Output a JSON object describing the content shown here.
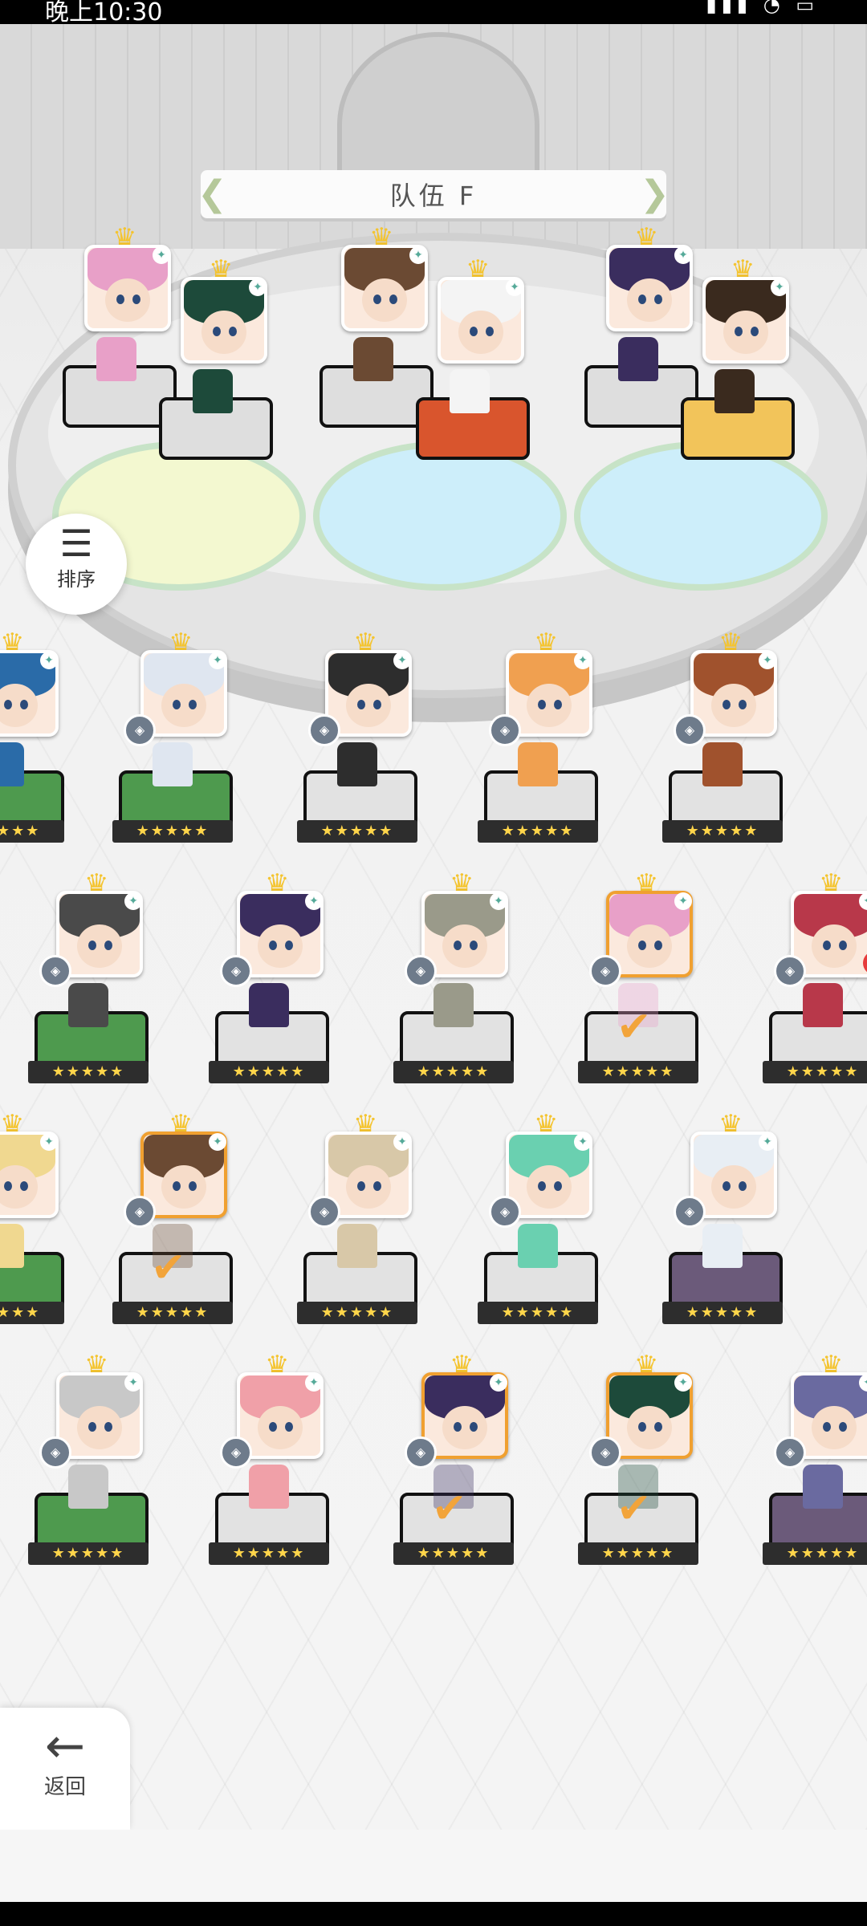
{
  "status_bar": {
    "time": "晚上10:30",
    "icons_text": "▮▮▮ ◔ ▭"
  },
  "team": {
    "title": "队伍 F"
  },
  "sort": {
    "label": "排序",
    "icon": "sort-icon"
  },
  "back": {
    "label": "返回",
    "icon": "arrow-left-icon"
  },
  "colors": {
    "selected_border": "#f0a030",
    "check": "#f2a43a",
    "alert": "#e63b3b",
    "crown": "#f4c430"
  },
  "team_slots": [
    {
      "hair": "#e8a0c8",
      "pedestal": "#dedede"
    },
    {
      "hair": "#1d4a3a",
      "pedestal": "#dedede"
    },
    {
      "hair": "#6b4a33",
      "pedestal": "#dedede"
    },
    {
      "hair": "#f4f4f4",
      "pedestal": "#d9552d"
    },
    {
      "hair": "#3a2d5e",
      "pedestal": "#dedede"
    },
    {
      "hair": "#3a2a1e",
      "pedestal": "#f2c45a"
    }
  ],
  "roster": [
    {
      "hair": "#2a6ba8",
      "pedestal": "#4e9a4e",
      "stars": "★★★★★",
      "selected": false
    },
    {
      "hair": "#dfe6f0",
      "pedestal": "#4e9a4e",
      "stars": "★★★★★",
      "selected": false
    },
    {
      "hair": "#2d2d2d",
      "pedestal": "#e2e2e2",
      "stars": "★★★★★",
      "selected": false
    },
    {
      "hair": "#f0a050",
      "pedestal": "#e2e2e2",
      "stars": "★★★★★",
      "selected": false
    },
    {
      "hair": "#a0522d",
      "pedestal": "#e2e2e2",
      "stars": "★★★★★",
      "selected": false
    },
    {
      "hair": "#4a4a4a",
      "pedestal": "#4e9a4e",
      "stars": "★★★★★",
      "selected": false
    },
    {
      "hair": "#3a2d5e",
      "pedestal": "#e2e2e2",
      "stars": "★★★★★",
      "selected": false
    },
    {
      "hair": "#9a9a8a",
      "pedestal": "#e2e2e2",
      "stars": "★★★★★",
      "selected": false
    },
    {
      "hair": "#e8a0c8",
      "pedestal": "#e2e2e2",
      "stars": "★★★★★",
      "selected": true
    },
    {
      "hair": "#b8384a",
      "pedestal": "#e2e2e2",
      "stars": "★★★★★",
      "selected": false,
      "alert": "!"
    },
    {
      "hair": "#f0d890",
      "pedestal": "#4e9a4e",
      "stars": "★★★★★",
      "selected": false
    },
    {
      "hair": "#6b4a33",
      "pedestal": "#e2e2e2",
      "stars": "★★★★★",
      "selected": true
    },
    {
      "hair": "#d8c8a8",
      "pedestal": "#e2e2e2",
      "stars": "★★★★★",
      "selected": false
    },
    {
      "hair": "#6ad0b0",
      "pedestal": "#e2e2e2",
      "stars": "★★★★★",
      "selected": false
    },
    {
      "hair": "#e8eef4",
      "pedestal": "#6b5a7a",
      "stars": "★★★★★",
      "selected": false
    },
    {
      "hair": "#c8c8c8",
      "pedestal": "#4e9a4e",
      "stars": "★★★★★",
      "selected": false
    },
    {
      "hair": "#f0a0a8",
      "pedestal": "#e2e2e2",
      "stars": "★★★★★",
      "selected": false
    },
    {
      "hair": "#3a2d5e",
      "pedestal": "#e2e2e2",
      "stars": "★★★★★",
      "selected": true
    },
    {
      "hair": "#1d4a3a",
      "pedestal": "#e2e2e2",
      "stars": "★★★★★",
      "selected": true
    },
    {
      "hair": "#6a6aa0",
      "pedestal": "#6b5a7a",
      "stars": "★★★★★",
      "selected": false
    }
  ]
}
